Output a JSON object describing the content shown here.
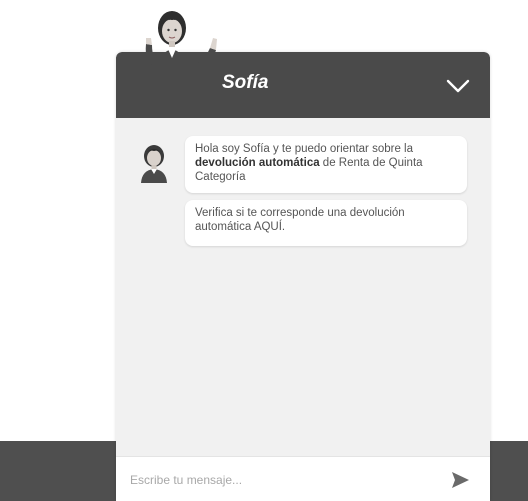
{
  "header": {
    "assistant_name": "Sofía",
    "collapse_icon": "chevron-down-icon",
    "background_color": "#4a4a4a"
  },
  "messages": [
    {
      "parts": [
        "Hola soy Sofía y te puedo orientar sobre la ",
        "devolución automática",
        " de Renta de Quinta Categoría"
      ]
    },
    {
      "text": "Verifica si te corresponde una devolución automática AQUÍ."
    }
  ],
  "composer": {
    "placeholder": "Escribe tu mensaje...",
    "send_icon": "send-icon"
  },
  "colors": {
    "chat_background": "#f1f1f1",
    "footer_band": "#4f4f4f"
  }
}
